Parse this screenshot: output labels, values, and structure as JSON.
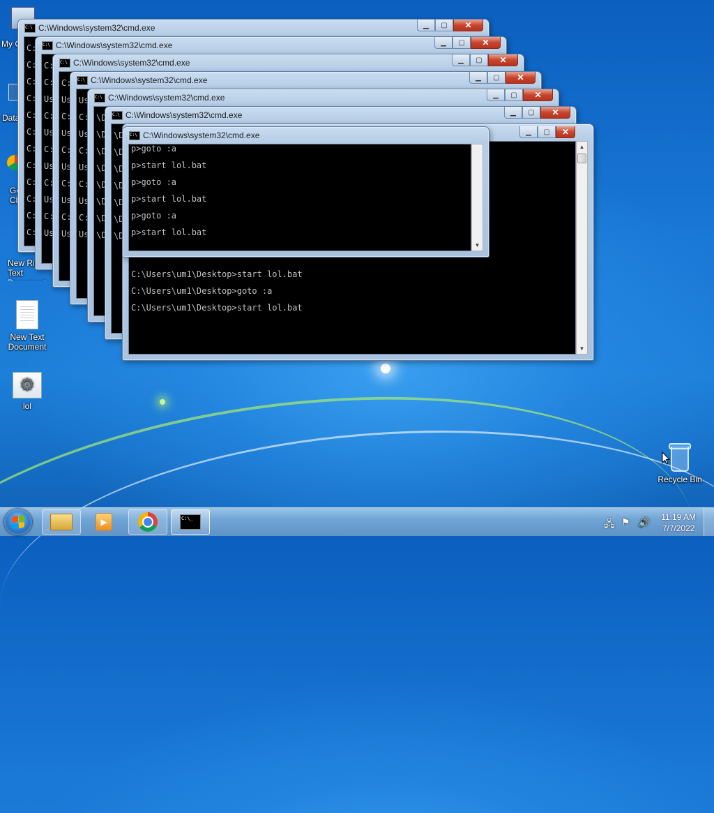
{
  "desktop": {
    "icons": [
      {
        "label": "My Computer"
      },
      {
        "label": "Data"
      },
      {
        "label": "Google Chrome"
      },
      {
        "label": "New Rich Text Document"
      },
      {
        "label": "New Text Document"
      },
      {
        "label": "lol"
      },
      {
        "label": "Recycle Bin"
      }
    ]
  },
  "windows": [
    {
      "title": "C:\\Windows\\system32\\cmd.exe",
      "visible_lines": [
        "C:",
        "C:",
        "C:",
        "C:",
        "C:",
        "C:",
        "C:",
        "C:",
        "C:",
        "C:",
        "C:",
        "C:"
      ]
    },
    {
      "title": "C:\\Windows\\system32\\cmd.exe",
      "visible_lines": [
        "C:",
        "C:",
        "Us",
        "C:",
        "Us",
        "C:",
        "Us",
        "C:",
        "Us",
        "C:",
        "Us"
      ]
    },
    {
      "title": "C:\\Windows\\system32\\cmd.exe",
      "visible_lines": [
        "C:",
        "Us",
        "C:",
        "Us",
        "C:",
        "Us",
        "C:",
        "Us",
        "C:",
        "Us"
      ]
    },
    {
      "title": "C:\\Windows\\system32\\cmd.exe",
      "visible_lines": [
        "Us",
        "C:",
        "Us",
        "C:",
        "Us",
        "C:",
        "Us",
        "C:",
        "Us"
      ]
    },
    {
      "title": "C:\\Windows\\system32\\cmd.exe",
      "visible_lines": [
        "\\De",
        "\\De",
        "\\De",
        "\\De",
        "\\De",
        "\\De",
        "\\De",
        "\\De"
      ]
    },
    {
      "title": "C:\\Windows\\system32\\cmd.exe",
      "visible_lines": [
        "\\De",
        "\\De",
        "\\De",
        "\\De",
        "\\De",
        "\\De",
        "\\De"
      ]
    },
    {
      "title": "C:\\Windows\\system32\\cmd.exe",
      "visible_lines": [
        "p>goto :a",
        "p>start lol.bat",
        "p>goto :a",
        "p>start lol.bat",
        "p>goto :a",
        "p>start lol.bat"
      ]
    }
  ],
  "back_lines": {
    "line1": "C:\\Users\\um1\\Desktop>start lol.bat",
    "line2": "C:\\Users\\um1\\Desktop>goto :a",
    "line3": "C:\\Users\\um1\\Desktop>start lol.bat",
    "line4": "C:\\Users\\um1\\Desktop>start lol.bat"
  },
  "taskbar": {
    "clock_time": "11:19 AM",
    "clock_date": "7/7/2022",
    "cmd_icon_text": "C:\\_"
  },
  "colors": {
    "close_button": "#c7462f",
    "console_bg": "#000000",
    "console_text": "#c0c0c0"
  }
}
